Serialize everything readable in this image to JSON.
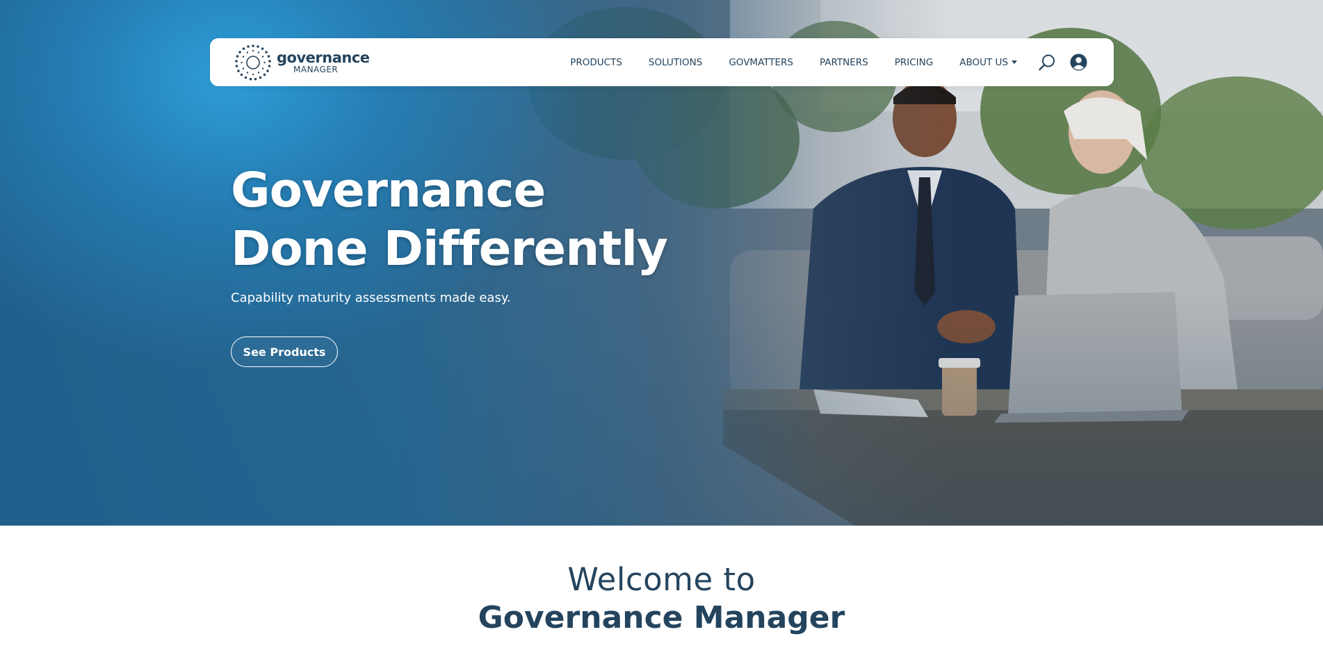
{
  "brand": {
    "logo_main": "governance",
    "logo_sub": "MANAGER",
    "logo_icon": "dotted-circle-logo-icon"
  },
  "nav": {
    "items": [
      {
        "label": "PRODUCTS"
      },
      {
        "label": "SOLUTIONS"
      },
      {
        "label": "GOVMATTERS"
      },
      {
        "label": "PARTNERS"
      },
      {
        "label": "PRICING"
      },
      {
        "label": "ABOUT US",
        "has_dropdown": true
      }
    ],
    "search_icon": "search-icon",
    "account_icon": "user-circle-icon"
  },
  "hero": {
    "title_line1": "Governance",
    "title_line2": "Done Differently",
    "subtitle": "Capability maturity assessments made easy.",
    "cta_label": "See Products",
    "background": "photo of two business people on a sofa looking at a laptop"
  },
  "welcome": {
    "line1": "Welcome to",
    "line2": "Governance Manager"
  },
  "colors": {
    "primary": "#24445e",
    "hero_blue": "#2a8fcf",
    "white": "#ffffff"
  }
}
